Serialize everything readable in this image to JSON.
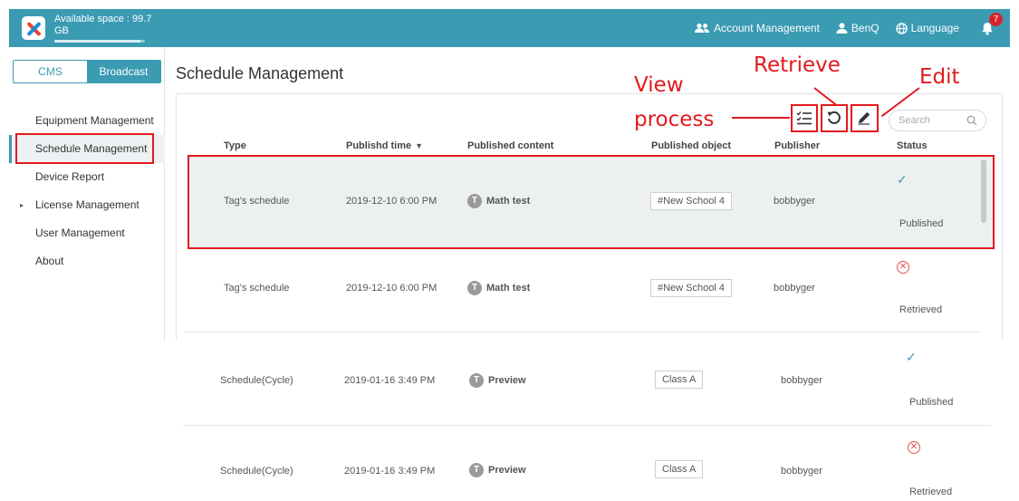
{
  "topbar": {
    "storage_text": "Available space : 99.7 GB",
    "storage_fraction": 0.95,
    "account_label": "Account Management",
    "user_label": "BenQ",
    "language_label": "Language",
    "notification_count": "7",
    "bar_color": "#3a9bb3"
  },
  "sidebar": {
    "mode_tabs": [
      "CMS",
      "Broadcast"
    ],
    "active_mode": "Broadcast",
    "items": [
      {
        "label": "Equipment Management"
      },
      {
        "label": "Schedule Management",
        "active": true
      },
      {
        "label": "Device Report"
      },
      {
        "label": "License Management",
        "expandable": true
      },
      {
        "label": "User Management"
      },
      {
        "label": "About"
      }
    ]
  },
  "main": {
    "title": "Schedule Management",
    "search_placeholder": "Search",
    "toolbar_icons": [
      "view-process-icon",
      "retrieve-icon",
      "edit-icon"
    ],
    "columns": [
      "Type",
      "Publishd time",
      "Published content",
      "Published object",
      "Publisher",
      "Status"
    ],
    "rows": [
      {
        "type": "Tag's schedule",
        "time": "2019-12-10 6:00 PM",
        "avatar": "T",
        "content": "Math test",
        "object": "#New School 4",
        "publisher": "bobbyger",
        "status": "Published",
        "status_icon": "check-icon"
      },
      {
        "type": "Tag's schedule",
        "time": "2019-12-10 6:00 PM",
        "avatar": "T",
        "content": "Math test",
        "object": "#New School 4",
        "publisher": "bobbyger",
        "status": "Retrieved",
        "status_icon": "cross-circle-icon"
      },
      {
        "type": "Schedule(Cycle)",
        "time": "2019-01-16 3:49 PM",
        "avatar": "T",
        "content": "Preview",
        "object": "Class A",
        "publisher": "bobbyger",
        "status": "Published",
        "status_icon": "check-icon"
      },
      {
        "type": "Schedule(Cycle)",
        "time": "2019-01-16 3:49 PM",
        "avatar": "T",
        "content": "Preview",
        "object": "Class A",
        "publisher": "bobbyger",
        "status": "Retrieved",
        "status_icon": "cross-circle-icon"
      }
    ]
  },
  "annotations": {
    "view_process_line1": "View",
    "view_process_line2": "process",
    "retrieve": "Retrieve",
    "edit": "Edit",
    "color": "#e3191e"
  }
}
